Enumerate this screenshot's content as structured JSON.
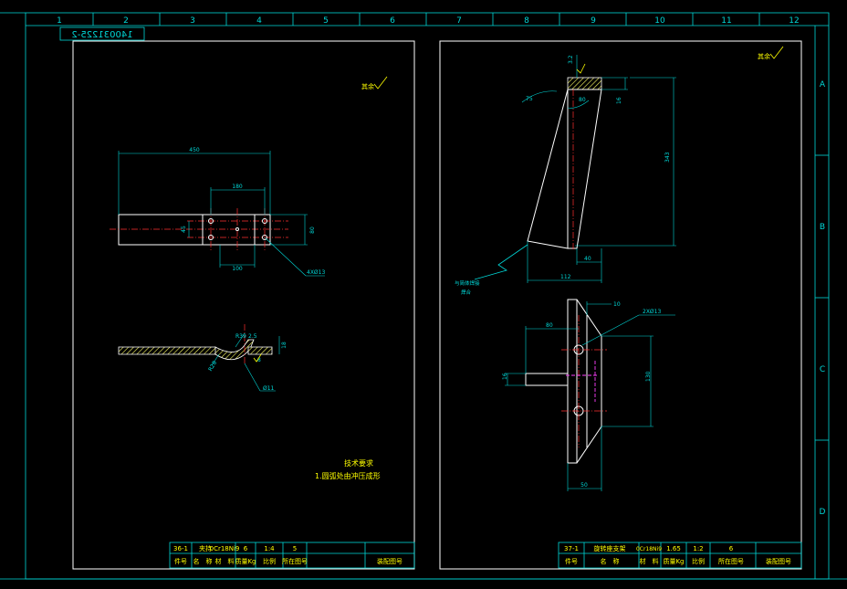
{
  "frame": {
    "columns": [
      "1",
      "2",
      "3",
      "4",
      "5",
      "6",
      "7",
      "8",
      "9",
      "10",
      "11",
      "12"
    ],
    "rows": [
      "A",
      "B",
      "C",
      "D"
    ],
    "drawing_number": "140031225-2"
  },
  "left_sheet": {
    "roughness_note": "其余",
    "plan_view": {
      "dim_length": "450",
      "dim_hole_span_top": "180",
      "dim_hole_span_bottom": "100",
      "dim_height": "80",
      "dim_hole_offset": "45",
      "hole_callout": "4XØ13"
    },
    "section_view": {
      "dim_radius": "R39",
      "dim_arc": "R28",
      "dim_small": "2.5",
      "dim_thickness": "8",
      "dim_bend": "18",
      "dim_hole": "Ø11"
    },
    "notes_title": "技术要求",
    "notes_item": "1.圆弧处由冲压成形",
    "title_block": {
      "row_values": [
        "36-1",
        "夹持",
        "0Cr18Ni9",
        "6",
        "1:4",
        "5"
      ],
      "row_headers": [
        "件号",
        "名　称",
        "材　料",
        "质量Kg",
        "比例",
        "所在图号",
        "装配图号"
      ]
    }
  },
  "right_sheet": {
    "roughness_note": "其余",
    "top_view": {
      "dim_top_small": "3.2",
      "dim_angle_left": "75",
      "dim_angle_right": "80",
      "dim_thickness": "16",
      "dim_height": "343",
      "dim_base_small": "40",
      "dim_base": "112",
      "weld_note_1": "与简体焊接",
      "weld_note_2": "焊合"
    },
    "side_view": {
      "dim_top": "10",
      "hole_callout": "2XØ13",
      "dim_plate": "80",
      "dim_thickness": "16",
      "dim_hole_span": "130",
      "dim_base": "50"
    },
    "title_block": {
      "row_values": [
        "37-1",
        "旋转座支架",
        "0Cr18Ni9",
        "1.65",
        "1:2",
        "6"
      ],
      "row_headers": [
        "件号",
        "名　称",
        "材　料",
        "质量Kg",
        "比例",
        "所在图号",
        "装配图号"
      ]
    }
  }
}
